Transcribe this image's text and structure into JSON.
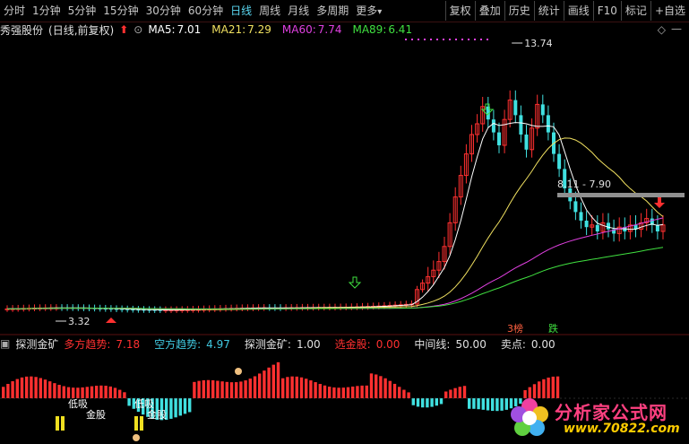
{
  "toolbar": {
    "periods": [
      "分时",
      "1分钟",
      "5分钟",
      "15分钟",
      "30分钟",
      "60分钟",
      "日线",
      "周线",
      "月线",
      "多周期",
      "更多"
    ],
    "active_period": "日线",
    "more_arrow": "▾",
    "right_buttons": [
      "复权",
      "叠加",
      "历史",
      "统计",
      "画线",
      "F10",
      "标记",
      "+自选"
    ]
  },
  "info": {
    "stock_name": "秀强股份",
    "mode": "(日线,前复权)",
    "ma": [
      {
        "label": "MA5:",
        "value": "7.01",
        "color": "#ffffff"
      },
      {
        "label": "MA21:",
        "value": "7.29",
        "color": "#f0e060"
      },
      {
        "label": "MA60:",
        "value": "7.74",
        "color": "#e040e0"
      },
      {
        "label": "MA89:",
        "value": "6.41",
        "color": "#40e040"
      }
    ]
  },
  "main_chart": {
    "high_label": "13.74",
    "low_label": "3.32",
    "range_label": "8.11 - 7.90",
    "bottom_tags": [
      "3榜",
      "跌"
    ]
  },
  "sub_info": {
    "indicator_name": "探测金矿",
    "items": [
      {
        "label": "多方趋势:",
        "value": "7.18",
        "color": "#ff3030"
      },
      {
        "label": "空方趋势:",
        "value": "4.97",
        "color": "#40c8e0"
      },
      {
        "label": "探测金矿:",
        "value": "1.00",
        "color": "#e0e0e0"
      },
      {
        "label": "选金股:",
        "value": "0.00",
        "color": "#ff3030"
      },
      {
        "label": "中间线:",
        "value": "50.00",
        "color": "#e0e0e0"
      },
      {
        "label": "卖点:",
        "value": "0.00",
        "color": "#e0e0e0"
      }
    ]
  },
  "sub_chart": {
    "buy_labels": [
      "低吸",
      "金股",
      "低吸",
      "金股"
    ]
  },
  "watermark": {
    "title": "分析家公式网",
    "url": "www.70822.com"
  },
  "colors": {
    "up": "#ff3030",
    "down": "#40e0e0",
    "ma5": "#ffffff",
    "ma21": "#f0e060",
    "ma60": "#e040e0",
    "ma89": "#40e040"
  }
}
